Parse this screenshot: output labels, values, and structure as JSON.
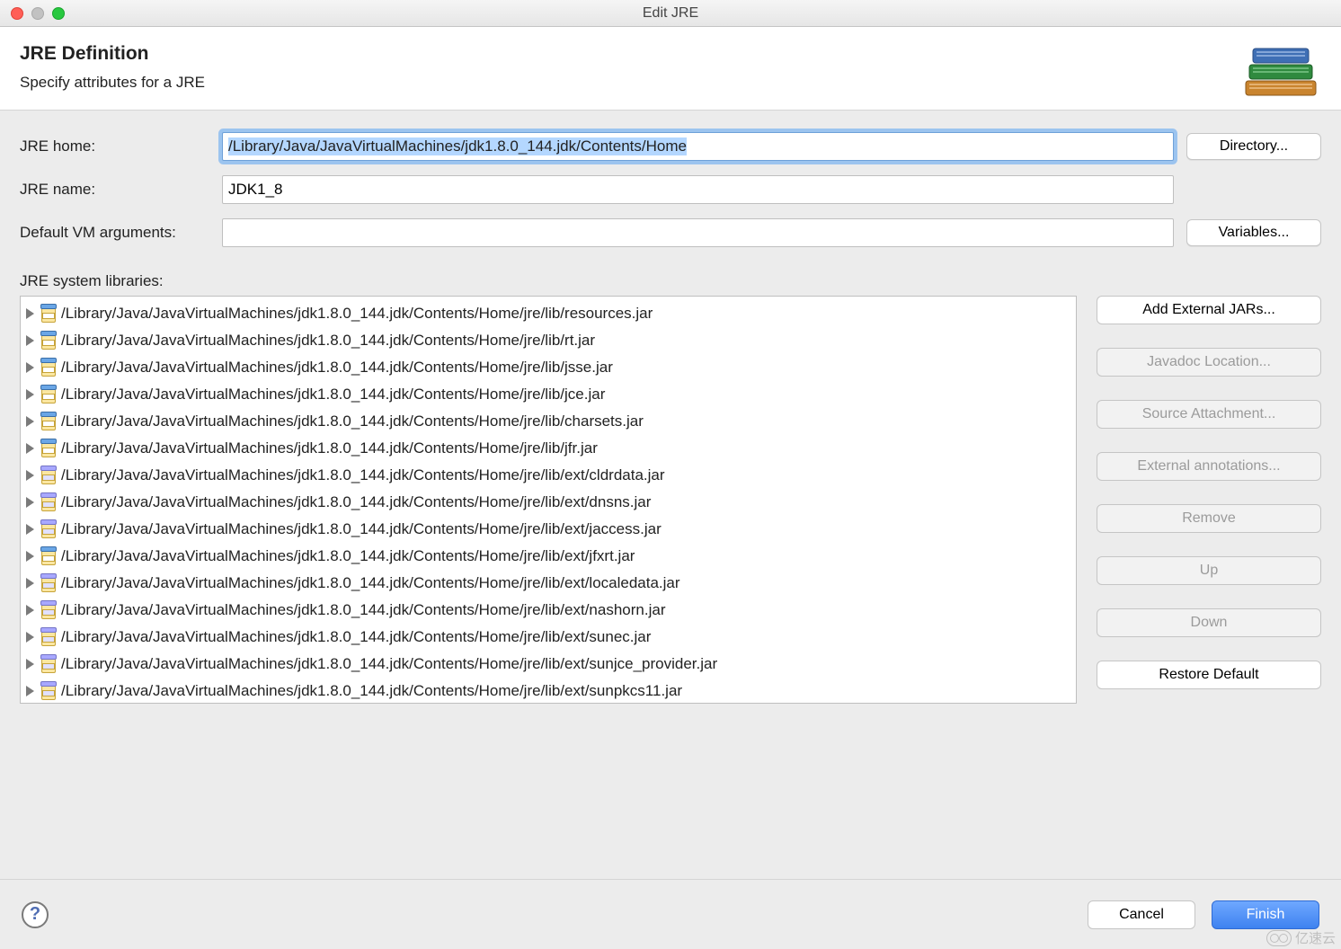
{
  "window": {
    "title": "Edit JRE"
  },
  "header": {
    "title": "JRE Definition",
    "subtitle": "Specify attributes for a JRE"
  },
  "form": {
    "jre_home": {
      "label": "JRE home:",
      "value": "/Library/Java/JavaVirtualMachines/jdk1.8.0_144.jdk/Contents/Home",
      "side_button": "Directory..."
    },
    "jre_name": {
      "label": "JRE name:",
      "value": "JDK1_8"
    },
    "vm_args": {
      "label": "Default VM arguments:",
      "value": "",
      "side_button": "Variables..."
    }
  },
  "libraries": {
    "label": "JRE system libraries:",
    "items": [
      {
        "path": "/Library/Java/JavaVirtualMachines/jdk1.8.0_144.jdk/Contents/Home/jre/lib/resources.jar",
        "ext": false
      },
      {
        "path": "/Library/Java/JavaVirtualMachines/jdk1.8.0_144.jdk/Contents/Home/jre/lib/rt.jar",
        "ext": false
      },
      {
        "path": "/Library/Java/JavaVirtualMachines/jdk1.8.0_144.jdk/Contents/Home/jre/lib/jsse.jar",
        "ext": false
      },
      {
        "path": "/Library/Java/JavaVirtualMachines/jdk1.8.0_144.jdk/Contents/Home/jre/lib/jce.jar",
        "ext": false
      },
      {
        "path": "/Library/Java/JavaVirtualMachines/jdk1.8.0_144.jdk/Contents/Home/jre/lib/charsets.jar",
        "ext": false
      },
      {
        "path": "/Library/Java/JavaVirtualMachines/jdk1.8.0_144.jdk/Contents/Home/jre/lib/jfr.jar",
        "ext": false
      },
      {
        "path": "/Library/Java/JavaVirtualMachines/jdk1.8.0_144.jdk/Contents/Home/jre/lib/ext/cldrdata.jar",
        "ext": true
      },
      {
        "path": "/Library/Java/JavaVirtualMachines/jdk1.8.0_144.jdk/Contents/Home/jre/lib/ext/dnsns.jar",
        "ext": true
      },
      {
        "path": "/Library/Java/JavaVirtualMachines/jdk1.8.0_144.jdk/Contents/Home/jre/lib/ext/jaccess.jar",
        "ext": true
      },
      {
        "path": "/Library/Java/JavaVirtualMachines/jdk1.8.0_144.jdk/Contents/Home/jre/lib/ext/jfxrt.jar",
        "ext": false
      },
      {
        "path": "/Library/Java/JavaVirtualMachines/jdk1.8.0_144.jdk/Contents/Home/jre/lib/ext/localedata.jar",
        "ext": true
      },
      {
        "path": "/Library/Java/JavaVirtualMachines/jdk1.8.0_144.jdk/Contents/Home/jre/lib/ext/nashorn.jar",
        "ext": true
      },
      {
        "path": "/Library/Java/JavaVirtualMachines/jdk1.8.0_144.jdk/Contents/Home/jre/lib/ext/sunec.jar",
        "ext": true
      },
      {
        "path": "/Library/Java/JavaVirtualMachines/jdk1.8.0_144.jdk/Contents/Home/jre/lib/ext/sunjce_provider.jar",
        "ext": true
      },
      {
        "path": "/Library/Java/JavaVirtualMachines/jdk1.8.0_144.jdk/Contents/Home/jre/lib/ext/sunpkcs11.jar",
        "ext": true
      }
    ],
    "buttons": {
      "add_external": {
        "label": "Add External JARs...",
        "enabled": true
      },
      "javadoc": {
        "label": "Javadoc Location...",
        "enabled": false
      },
      "source": {
        "label": "Source Attachment...",
        "enabled": false
      },
      "ext_annot": {
        "label": "External annotations...",
        "enabled": false
      },
      "remove": {
        "label": "Remove",
        "enabled": false
      },
      "up": {
        "label": "Up",
        "enabled": false
      },
      "down": {
        "label": "Down",
        "enabled": false
      },
      "restore": {
        "label": "Restore Default",
        "enabled": true
      }
    }
  },
  "footer": {
    "cancel": "Cancel",
    "finish": "Finish"
  },
  "watermark": "亿速云"
}
